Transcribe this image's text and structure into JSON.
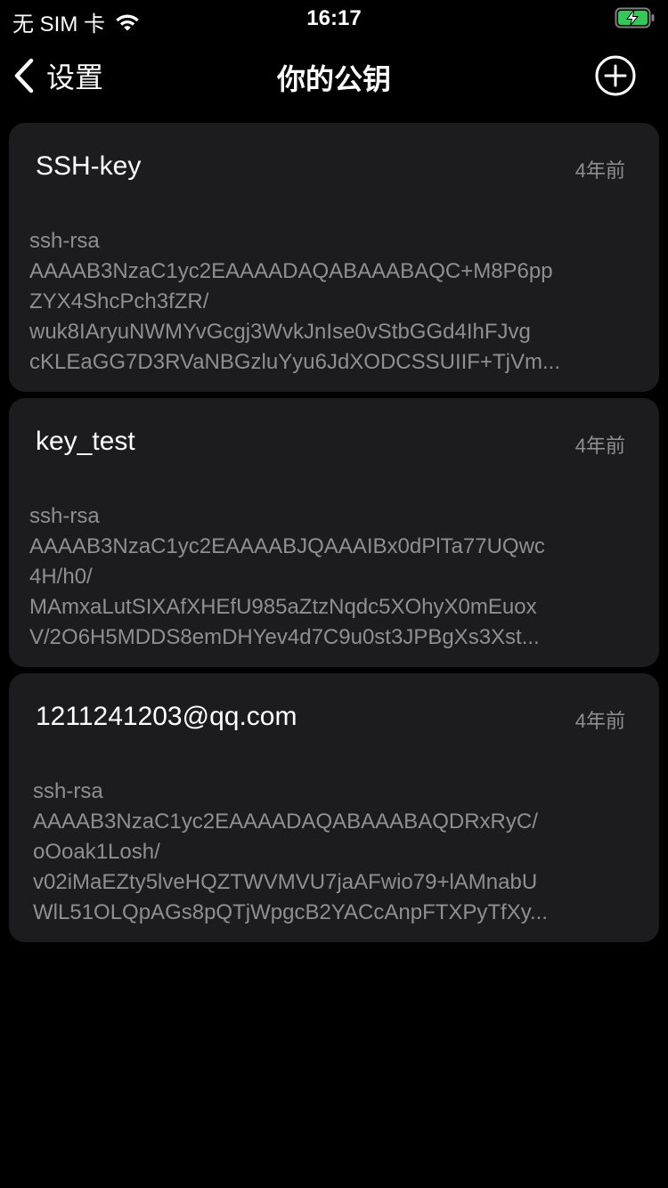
{
  "status_bar": {
    "carrier": "无 SIM 卡",
    "time": "16:17"
  },
  "nav": {
    "back_label": "设置",
    "title": "你的公钥"
  },
  "keys": [
    {
      "name": "SSH-key",
      "time": "4年前",
      "lines": [
        "ssh-rsa",
        "AAAAB3NzaC1yc2EAAAADAQABAAABAQC+M8P6pp",
        "ZYX4ShcPch3fZR/",
        "wuk8IAryuNWMYvGcgj3WvkJnIse0vStbGGd4IhFJvg",
        "cKLEaGG7D3RVaNBGzluYyu6JdXODCSSUIIF+TjVm..."
      ]
    },
    {
      "name": "key_test",
      "time": "4年前",
      "lines": [
        "ssh-rsa",
        "AAAAB3NzaC1yc2EAAAABJQAAAIBx0dPlTa77UQwc",
        "4H/h0/",
        "MAmxaLutSIXAfXHEfU985aZtzNqdc5XOhyX0mEuox",
        "V/2O6H5MDDS8emDHYev4d7C9u0st3JPBgXs3Xst..."
      ]
    },
    {
      "name": "1211241203@qq.com",
      "time": "4年前",
      "lines": [
        "ssh-rsa",
        "AAAAB3NzaC1yc2EAAAADAQABAAABAQDRxRyC/",
        "oOoak1Losh/",
        "v02iMaEZty5lveHQZTWVMVU7jaAFwio79+lAMnabU",
        "WlL51OLQpAGs8pQTjWpgcB2YACcAnpFTXPyTfXy..."
      ]
    }
  ]
}
